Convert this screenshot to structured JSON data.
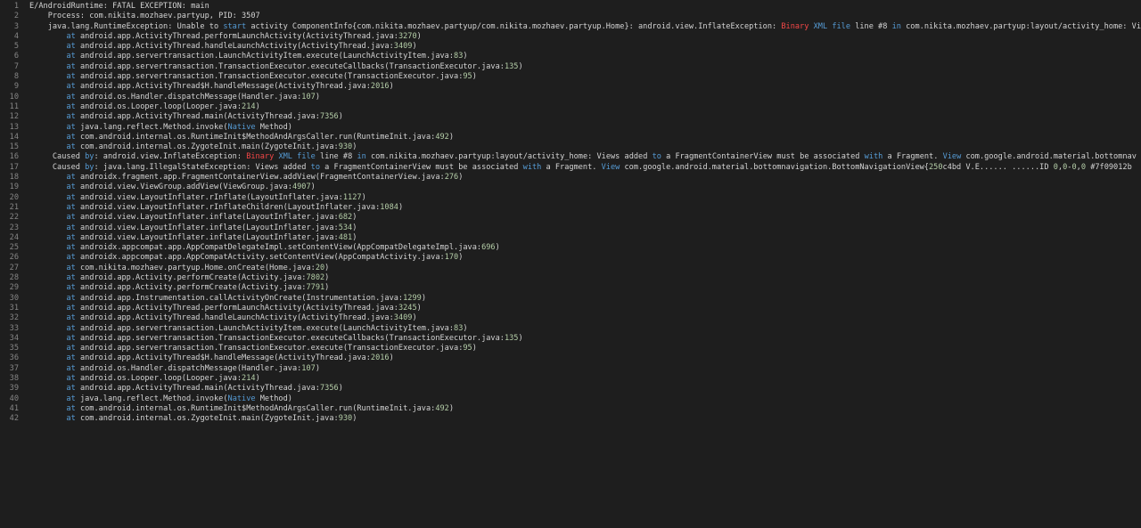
{
  "colors": {
    "background": "#1e1e1e",
    "text": "#d4d4d4",
    "line_number": "#858585",
    "keyword": "#569cd6",
    "number": "#b5cea8",
    "error": "#f44747"
  },
  "lines": [
    [
      {
        "t": "E/AndroidRuntime: FATAL EXCEPTION: main"
      }
    ],
    [
      {
        "t": "    Process: com.nikita.mozhaev.partyup, PID: 3507"
      }
    ],
    [
      {
        "t": "    java.lang.RuntimeException: Unable to "
      },
      {
        "t": "start",
        "c": "kw"
      },
      {
        "t": " activity ComponentInfo{com.nikita.mozhaev.partyup/com.nikita.mozhaev.partyup.Home}: android.view.InflateException: "
      },
      {
        "t": "Binary",
        "c": "red"
      },
      {
        "t": " "
      },
      {
        "t": "XML",
        "c": "kw"
      },
      {
        "t": " "
      },
      {
        "t": "file",
        "c": "kw"
      },
      {
        "t": " line #8 "
      },
      {
        "t": "in",
        "c": "kw"
      },
      {
        "t": " com.nikita.mozhaev.partyup:layout/activity_home: Views added to a FragmentContainerView must be associated with a Fragment."
      }
    ],
    [
      {
        "t": "        "
      },
      {
        "t": "at",
        "c": "kw"
      },
      {
        "t": " android.app.ActivityThread.performLaunchActivity(ActivityThread.java:"
      },
      {
        "t": "3270",
        "c": "num"
      },
      {
        "t": ")"
      }
    ],
    [
      {
        "t": "        "
      },
      {
        "t": "at",
        "c": "kw"
      },
      {
        "t": " android.app.ActivityThread.handleLaunchActivity(ActivityThread.java:"
      },
      {
        "t": "3409",
        "c": "num"
      },
      {
        "t": ")"
      }
    ],
    [
      {
        "t": "        "
      },
      {
        "t": "at",
        "c": "kw"
      },
      {
        "t": " android.app.servertransaction.LaunchActivityItem.execute(LaunchActivityItem.java:"
      },
      {
        "t": "83",
        "c": "num"
      },
      {
        "t": ")"
      }
    ],
    [
      {
        "t": "        "
      },
      {
        "t": "at",
        "c": "kw"
      },
      {
        "t": " android.app.servertransaction.TransactionExecutor.executeCallbacks(TransactionExecutor.java:"
      },
      {
        "t": "135",
        "c": "num"
      },
      {
        "t": ")"
      }
    ],
    [
      {
        "t": "        "
      },
      {
        "t": "at",
        "c": "kw"
      },
      {
        "t": " android.app.servertransaction.TransactionExecutor.execute(TransactionExecutor.java:"
      },
      {
        "t": "95",
        "c": "num"
      },
      {
        "t": ")"
      }
    ],
    [
      {
        "t": "        "
      },
      {
        "t": "at",
        "c": "kw"
      },
      {
        "t": " android.app.ActivityThread$H.handleMessage(ActivityThread.java:"
      },
      {
        "t": "2016",
        "c": "num"
      },
      {
        "t": ")"
      }
    ],
    [
      {
        "t": "        "
      },
      {
        "t": "at",
        "c": "kw"
      },
      {
        "t": " android.os.Handler.dispatchMessage(Handler.java:"
      },
      {
        "t": "107",
        "c": "num"
      },
      {
        "t": ")"
      }
    ],
    [
      {
        "t": "        "
      },
      {
        "t": "at",
        "c": "kw"
      },
      {
        "t": " android.os.Looper.loop(Looper.java:"
      },
      {
        "t": "214",
        "c": "num"
      },
      {
        "t": ")"
      }
    ],
    [
      {
        "t": "        "
      },
      {
        "t": "at",
        "c": "kw"
      },
      {
        "t": " android.app.ActivityThread.main(ActivityThread.java:"
      },
      {
        "t": "7356",
        "c": "num"
      },
      {
        "t": ")"
      }
    ],
    [
      {
        "t": "        "
      },
      {
        "t": "at",
        "c": "kw"
      },
      {
        "t": " java.lang.reflect.Method.invoke("
      },
      {
        "t": "Native",
        "c": "kw"
      },
      {
        "t": " Method)"
      }
    ],
    [
      {
        "t": "        "
      },
      {
        "t": "at",
        "c": "kw"
      },
      {
        "t": " com.android.internal.os.RuntimeInit$MethodAndArgsCaller.run(RuntimeInit.java:"
      },
      {
        "t": "492",
        "c": "num"
      },
      {
        "t": ")"
      }
    ],
    [
      {
        "t": "        "
      },
      {
        "t": "at",
        "c": "kw"
      },
      {
        "t": " com.android.internal.os.ZygoteInit.main(ZygoteInit.java:"
      },
      {
        "t": "930",
        "c": "num"
      },
      {
        "t": ")"
      }
    ],
    [
      {
        "t": "     Caused "
      },
      {
        "t": "by",
        "c": "kw"
      },
      {
        "t": ": android.view.InflateException: "
      },
      {
        "t": "Binary",
        "c": "red"
      },
      {
        "t": " "
      },
      {
        "t": "XML",
        "c": "kw"
      },
      {
        "t": " "
      },
      {
        "t": "file",
        "c": "kw"
      },
      {
        "t": " line #8 "
      },
      {
        "t": "in",
        "c": "kw"
      },
      {
        "t": " com.nikita.mozhaev.partyup:layout/activity_home: Views added "
      },
      {
        "t": "to",
        "c": "kw"
      },
      {
        "t": " a FragmentContainerView must be associated "
      },
      {
        "t": "with",
        "c": "kw"
      },
      {
        "t": " a Fragment. "
      },
      {
        "t": "View",
        "c": "kw"
      },
      {
        "t": " com.google.android.material.bottomnav"
      }
    ],
    [
      {
        "t": "     Caused "
      },
      {
        "t": "by",
        "c": "kw"
      },
      {
        "t": ": java.lang.IllegalStateException: Views added "
      },
      {
        "t": "to",
        "c": "kw"
      },
      {
        "t": " a FragmentContainerView must be associated "
      },
      {
        "t": "with",
        "c": "kw"
      },
      {
        "t": " a Fragment. "
      },
      {
        "t": "View",
        "c": "kw"
      },
      {
        "t": " com.google.android.material.bottomnavigation.BottomNavigationView{"
      },
      {
        "t": "250",
        "c": "num"
      },
      {
        "t": "c4bd V.E...... ......ID "
      },
      {
        "t": "0",
        "c": "num"
      },
      {
        "t": ","
      },
      {
        "t": "0",
        "c": "num"
      },
      {
        "t": "-"
      },
      {
        "t": "0",
        "c": "num"
      },
      {
        "t": ","
      },
      {
        "t": "0",
        "c": "num"
      },
      {
        "t": " #7f09012b"
      }
    ],
    [
      {
        "t": "        "
      },
      {
        "t": "at",
        "c": "kw"
      },
      {
        "t": " androidx.fragment.app.FragmentContainerView.addView(FragmentContainerView.java:"
      },
      {
        "t": "276",
        "c": "num"
      },
      {
        "t": ")"
      }
    ],
    [
      {
        "t": "        "
      },
      {
        "t": "at",
        "c": "kw"
      },
      {
        "t": " android.view.ViewGroup.addView(ViewGroup.java:"
      },
      {
        "t": "4907",
        "c": "num"
      },
      {
        "t": ")"
      }
    ],
    [
      {
        "t": "        "
      },
      {
        "t": "at",
        "c": "kw"
      },
      {
        "t": " android.view.LayoutInflater.rInflate(LayoutInflater.java:"
      },
      {
        "t": "1127",
        "c": "num"
      },
      {
        "t": ")"
      }
    ],
    [
      {
        "t": "        "
      },
      {
        "t": "at",
        "c": "kw"
      },
      {
        "t": " android.view.LayoutInflater.rInflateChildren(LayoutInflater.java:"
      },
      {
        "t": "1084",
        "c": "num"
      },
      {
        "t": ")"
      }
    ],
    [
      {
        "t": "        "
      },
      {
        "t": "at",
        "c": "kw"
      },
      {
        "t": " android.view.LayoutInflater.inflate(LayoutInflater.java:"
      },
      {
        "t": "682",
        "c": "num"
      },
      {
        "t": ")"
      }
    ],
    [
      {
        "t": "        "
      },
      {
        "t": "at",
        "c": "kw"
      },
      {
        "t": " android.view.LayoutInflater.inflate(LayoutInflater.java:"
      },
      {
        "t": "534",
        "c": "num"
      },
      {
        "t": ")"
      }
    ],
    [
      {
        "t": "        "
      },
      {
        "t": "at",
        "c": "kw"
      },
      {
        "t": " android.view.LayoutInflater.inflate(LayoutInflater.java:"
      },
      {
        "t": "481",
        "c": "num"
      },
      {
        "t": ")"
      }
    ],
    [
      {
        "t": "        "
      },
      {
        "t": "at",
        "c": "kw"
      },
      {
        "t": " androidx.appcompat.app.AppCompatDelegateImpl.setContentView(AppCompatDelegateImpl.java:"
      },
      {
        "t": "696",
        "c": "num"
      },
      {
        "t": ")"
      }
    ],
    [
      {
        "t": "        "
      },
      {
        "t": "at",
        "c": "kw"
      },
      {
        "t": " androidx.appcompat.app.AppCompatActivity.setContentView(AppCompatActivity.java:"
      },
      {
        "t": "170",
        "c": "num"
      },
      {
        "t": ")"
      }
    ],
    [
      {
        "t": "        "
      },
      {
        "t": "at",
        "c": "kw"
      },
      {
        "t": " com.nikita.mozhaev.partyup.Home.onCreate(Home.java:"
      },
      {
        "t": "20",
        "c": "num"
      },
      {
        "t": ")"
      }
    ],
    [
      {
        "t": "        "
      },
      {
        "t": "at",
        "c": "kw"
      },
      {
        "t": " android.app.Activity.performCreate(Activity.java:"
      },
      {
        "t": "7802",
        "c": "num"
      },
      {
        "t": ")"
      }
    ],
    [
      {
        "t": "        "
      },
      {
        "t": "at",
        "c": "kw"
      },
      {
        "t": " android.app.Activity.performCreate(Activity.java:"
      },
      {
        "t": "7791",
        "c": "num"
      },
      {
        "t": ")"
      }
    ],
    [
      {
        "t": "        "
      },
      {
        "t": "at",
        "c": "kw"
      },
      {
        "t": " android.app.Instrumentation.callActivityOnCreate(Instrumentation.java:"
      },
      {
        "t": "1299",
        "c": "num"
      },
      {
        "t": ")"
      }
    ],
    [
      {
        "t": "        "
      },
      {
        "t": "at",
        "c": "kw"
      },
      {
        "t": " android.app.ActivityThread.performLaunchActivity(ActivityThread.java:"
      },
      {
        "t": "3245",
        "c": "num"
      },
      {
        "t": ")"
      }
    ],
    [
      {
        "t": "        "
      },
      {
        "t": "at",
        "c": "kw"
      },
      {
        "t": " android.app.ActivityThread.handleLaunchActivity(ActivityThread.java:"
      },
      {
        "t": "3409",
        "c": "num"
      },
      {
        "t": ")"
      }
    ],
    [
      {
        "t": "        "
      },
      {
        "t": "at",
        "c": "kw"
      },
      {
        "t": " android.app.servertransaction.LaunchActivityItem.execute(LaunchActivityItem.java:"
      },
      {
        "t": "83",
        "c": "num"
      },
      {
        "t": ")"
      }
    ],
    [
      {
        "t": "        "
      },
      {
        "t": "at",
        "c": "kw"
      },
      {
        "t": " android.app.servertransaction.TransactionExecutor.executeCallbacks(TransactionExecutor.java:"
      },
      {
        "t": "135",
        "c": "num"
      },
      {
        "t": ")"
      }
    ],
    [
      {
        "t": "        "
      },
      {
        "t": "at",
        "c": "kw"
      },
      {
        "t": " android.app.servertransaction.TransactionExecutor.execute(TransactionExecutor.java:"
      },
      {
        "t": "95",
        "c": "num"
      },
      {
        "t": ")"
      }
    ],
    [
      {
        "t": "        "
      },
      {
        "t": "at",
        "c": "kw"
      },
      {
        "t": " android.app.ActivityThread$H.handleMessage(ActivityThread.java:"
      },
      {
        "t": "2016",
        "c": "num"
      },
      {
        "t": ")"
      }
    ],
    [
      {
        "t": "        "
      },
      {
        "t": "at",
        "c": "kw"
      },
      {
        "t": " android.os.Handler.dispatchMessage(Handler.java:"
      },
      {
        "t": "107",
        "c": "num"
      },
      {
        "t": ")"
      }
    ],
    [
      {
        "t": "        "
      },
      {
        "t": "at",
        "c": "kw"
      },
      {
        "t": " android.os.Looper.loop(Looper.java:"
      },
      {
        "t": "214",
        "c": "num"
      },
      {
        "t": ")"
      }
    ],
    [
      {
        "t": "        "
      },
      {
        "t": "at",
        "c": "kw"
      },
      {
        "t": " android.app.ActivityThread.main(ActivityThread.java:"
      },
      {
        "t": "7356",
        "c": "num"
      },
      {
        "t": ")"
      }
    ],
    [
      {
        "t": "        "
      },
      {
        "t": "at",
        "c": "kw"
      },
      {
        "t": " java.lang.reflect.Method.invoke("
      },
      {
        "t": "Native",
        "c": "kw"
      },
      {
        "t": " Method)"
      }
    ],
    [
      {
        "t": "        "
      },
      {
        "t": "at",
        "c": "kw"
      },
      {
        "t": " com.android.internal.os.RuntimeInit$MethodAndArgsCaller.run(RuntimeInit.java:"
      },
      {
        "t": "492",
        "c": "num"
      },
      {
        "t": ")"
      }
    ],
    [
      {
        "t": "        "
      },
      {
        "t": "at",
        "c": "kw"
      },
      {
        "t": " com.android.internal.os.ZygoteInit.main(ZygoteInit.java:"
      },
      {
        "t": "930",
        "c": "num"
      },
      {
        "t": ")"
      }
    ]
  ]
}
